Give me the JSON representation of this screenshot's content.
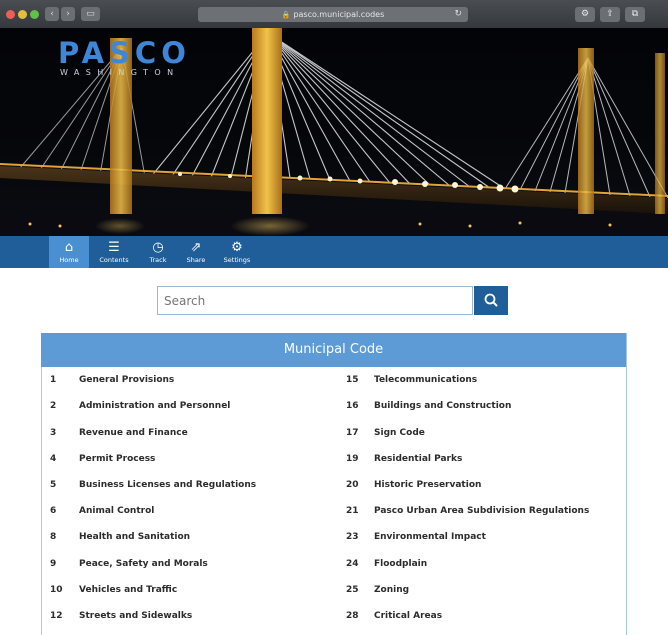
{
  "browser": {
    "address": "pasco.municipal.codes",
    "colors": {
      "chrome": "#3d4044",
      "address_bar": "#6d7075"
    }
  },
  "header": {
    "logo": "PASCO",
    "logo_sub": "WASHINGTON"
  },
  "nav": {
    "items": [
      {
        "label": "Home",
        "icon": "home-icon"
      },
      {
        "label": "Contents",
        "icon": "list-icon"
      },
      {
        "label": "Track",
        "icon": "gauge-icon"
      },
      {
        "label": "Share",
        "icon": "share-icon"
      },
      {
        "label": "Settings",
        "icon": "gears-icon"
      }
    ],
    "active": "Home"
  },
  "search": {
    "placeholder": "Search"
  },
  "panel": {
    "title": "Municipal Code"
  },
  "codes": {
    "left": [
      {
        "num": "1",
        "title": "General Provisions"
      },
      {
        "num": "2",
        "title": "Administration and Personnel"
      },
      {
        "num": "3",
        "title": "Revenue and Finance"
      },
      {
        "num": "4",
        "title": "Permit Process"
      },
      {
        "num": "5",
        "title": "Business Licenses and Regulations"
      },
      {
        "num": "6",
        "title": "Animal Control"
      },
      {
        "num": "8",
        "title": "Health and Sanitation"
      },
      {
        "num": "9",
        "title": "Peace, Safety and Morals"
      },
      {
        "num": "10",
        "title": "Vehicles and Traffic"
      },
      {
        "num": "12",
        "title": "Streets and Sidewalks"
      }
    ],
    "right": [
      {
        "num": "15",
        "title": "Telecommunications"
      },
      {
        "num": "16",
        "title": "Buildings and Construction"
      },
      {
        "num": "17",
        "title": "Sign Code"
      },
      {
        "num": "19",
        "title": "Residential Parks"
      },
      {
        "num": "20",
        "title": "Historic Preservation"
      },
      {
        "num": "21",
        "title": "Pasco Urban Area Subdivision Regulations"
      },
      {
        "num": "23",
        "title": "Environmental Impact"
      },
      {
        "num": "24",
        "title": "Floodplain"
      },
      {
        "num": "25",
        "title": "Zoning"
      },
      {
        "num": "28",
        "title": "Critical Areas"
      }
    ]
  },
  "colors": {
    "brand_blue": "#1f5e98",
    "panel_header": "#5c9bd6",
    "logo": "#3e86d8"
  }
}
